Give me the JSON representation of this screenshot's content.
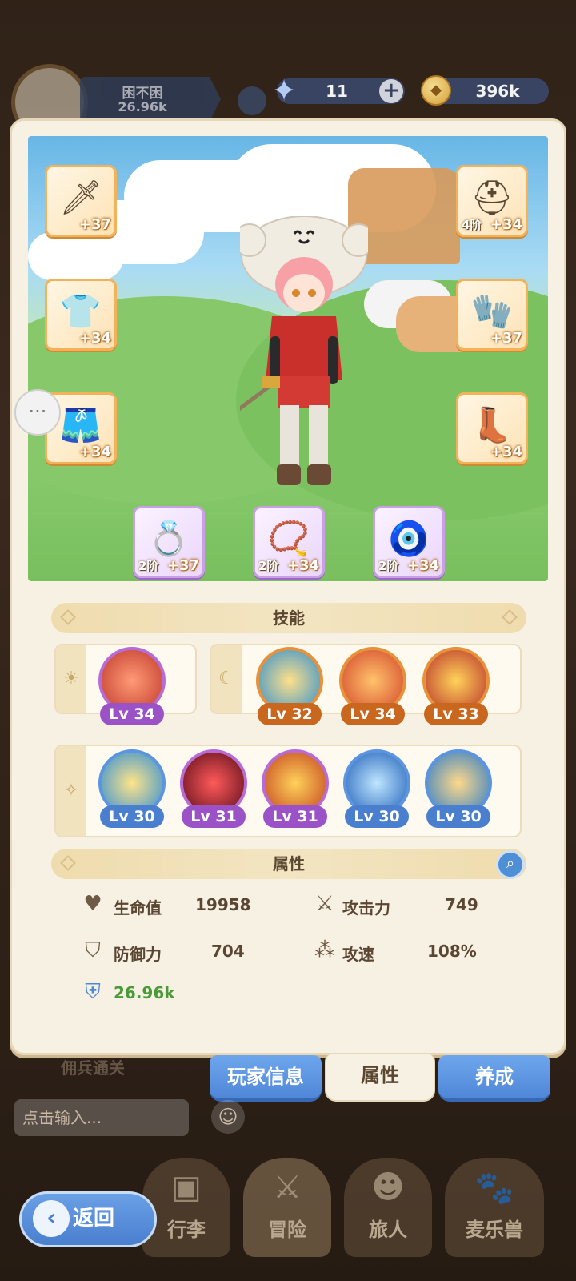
{
  "hud": {
    "player_name": "困不困",
    "power": "26.96k",
    "gems": "11",
    "gem_plus": "+",
    "gold": "396k"
  },
  "equipment": {
    "weapon": {
      "level": "+37"
    },
    "helmet": {
      "tier": "4阶",
      "level": "+34"
    },
    "armor": {
      "level": "+34"
    },
    "gloves": {
      "level": "+37"
    },
    "pants": {
      "level": "+34"
    },
    "boots": {
      "level": "+34"
    },
    "ring": {
      "tier": "2阶",
      "level": "+37"
    },
    "necklace": {
      "tier": "2阶",
      "level": "+34"
    },
    "amulet": {
      "tier": "2阶",
      "level": "+34"
    }
  },
  "skills": {
    "title": "技能",
    "sun_row": [
      {
        "level": "Lv 34"
      }
    ],
    "moon_row": [
      {
        "level": "Lv 32"
      },
      {
        "level": "Lv 34"
      },
      {
        "level": "Lv 33"
      }
    ],
    "star_row": [
      {
        "level": "Lv 30"
      },
      {
        "level": "Lv 31"
      },
      {
        "level": "Lv 31"
      },
      {
        "level": "Lv 30"
      },
      {
        "level": "Lv 30"
      }
    ]
  },
  "attributes": {
    "title": "属性",
    "hp_label": "生命值",
    "hp_value": "19958",
    "atk_label": "攻击力",
    "atk_value": "749",
    "def_label": "防御力",
    "def_value": "704",
    "spd_label": "攻速",
    "spd_value": "108%",
    "power_value": "26.96k"
  },
  "tabs": {
    "player_info": "玩家信息",
    "attributes": "属性",
    "train": "养成"
  },
  "background": {
    "mercenary_text": "佣兵通关",
    "chat_placeholder": "点击输入...",
    "nav": [
      "行李",
      "冒险",
      "旅人",
      "麦乐兽"
    ],
    "back": "返回"
  },
  "colors": {
    "panel": "#f7f1e3",
    "tab_blue": "#4f87d8",
    "power_green": "#4a9a3a",
    "skill_purple": "#9a52c6",
    "skill_orange": "#c9671e",
    "skill_blue": "#4a7fcf"
  }
}
